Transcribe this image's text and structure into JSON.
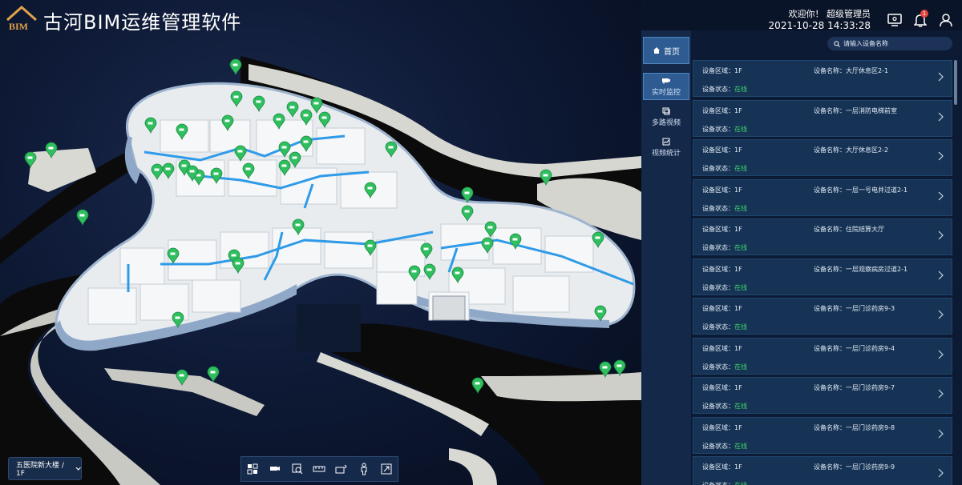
{
  "app": {
    "title": "古河BIM运维管理软件",
    "logo_text": "BIM"
  },
  "header": {
    "greeting": "欢迎你！ 超级管理员",
    "datetime": "2021-10-28 14:33:28",
    "notification_count": "1"
  },
  "nav": {
    "home_label": "首页",
    "items": [
      {
        "label": "实时监控",
        "icon": "camera-icon"
      },
      {
        "label": "多路视频",
        "icon": "video-icon"
      },
      {
        "label": "视频统计",
        "icon": "stats-icon"
      }
    ]
  },
  "search": {
    "placeholder": "请输入设备名称"
  },
  "devices": [
    {
      "area_label": "设备区域：",
      "area": "1F",
      "name_label": "设备名称：",
      "name": "大厅休息区2-1",
      "status_label": "设备状态：",
      "status": "在线"
    },
    {
      "area_label": "设备区域：",
      "area": "1F",
      "name_label": "设备名称：",
      "name": "一层消防电梯前室",
      "status_label": "设备状态：",
      "status": "在线"
    },
    {
      "area_label": "设备区域：",
      "area": "1F",
      "name_label": "设备名称：",
      "name": "大厅休息区2-2",
      "status_label": "设备状态：",
      "status": "在线"
    },
    {
      "area_label": "设备区域：",
      "area": "1F",
      "name_label": "设备名称：",
      "name": "一层一号电井过道2-1",
      "status_label": "设备状态：",
      "status": "在线"
    },
    {
      "area_label": "设备区域：",
      "area": "1F",
      "name_label": "设备名称：",
      "name": "住院结算大厅",
      "status_label": "设备状态：",
      "status": "在线"
    },
    {
      "area_label": "设备区域：",
      "area": "1F",
      "name_label": "设备名称：",
      "name": "一层观察病房过道2-1",
      "status_label": "设备状态：",
      "status": "在线"
    },
    {
      "area_label": "设备区域：",
      "area": "1F",
      "name_label": "设备名称：",
      "name": "一层门诊药房9-3",
      "status_label": "设备状态：",
      "status": "在线"
    },
    {
      "area_label": "设备区域：",
      "area": "1F",
      "name_label": "设备名称：",
      "name": "一层门诊药房9-4",
      "status_label": "设备状态：",
      "status": "在线"
    },
    {
      "area_label": "设备区域：",
      "area": "1F",
      "name_label": "设备名称：",
      "name": "一层门诊药房9-7",
      "status_label": "设备状态：",
      "status": "在线"
    },
    {
      "area_label": "设备区域：",
      "area": "1F",
      "name_label": "设备名称：",
      "name": "一层门诊药房9-8",
      "status_label": "设备状态：",
      "status": "在线"
    },
    {
      "area_label": "设备区域：",
      "area": "1F",
      "name_label": "设备名称：",
      "name": "一层门诊药房9-9",
      "status_label": "设备状态：",
      "status": "在线"
    }
  ],
  "floor_selector": {
    "value": "五医院新大楼 / 1F"
  },
  "toolbar": {
    "buttons": [
      "grid-view-icon",
      "camera-icon",
      "zoom-area-icon",
      "measure-icon",
      "floor-split-icon",
      "person-icon",
      "fullscreen-icon"
    ]
  },
  "colors": {
    "accent": "#2d5b92",
    "online": "#3fd66b",
    "marker": "#2fbf5f",
    "pipe": "#2f9be8",
    "card": "#163355",
    "panel": "#0d1a33"
  }
}
